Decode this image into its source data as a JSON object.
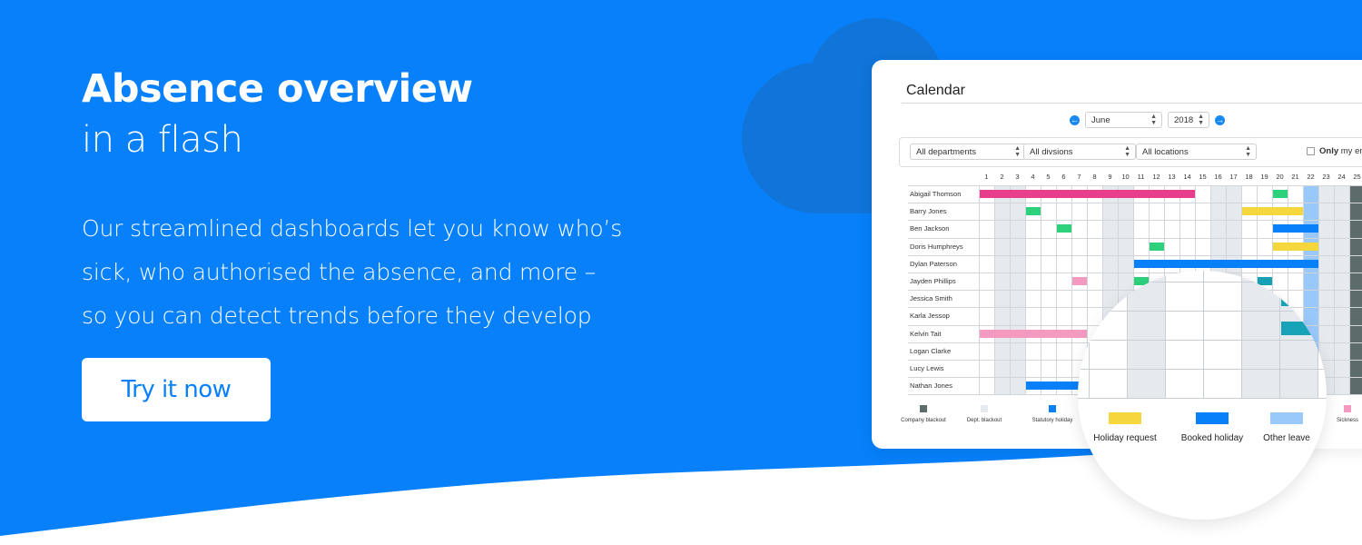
{
  "hero": {
    "headline": "Absence overview",
    "subheadline": "in a flash",
    "body_lines": [
      "Our streamlined dashboards let you know who’s",
      "sick, who authorised the absence, and more –",
      "so you can detect trends before they develop"
    ],
    "cta_label": "Try it now"
  },
  "colors": {
    "brand_blue": "#0780fa",
    "cloud": "#1074d9",
    "weekend": "#e6e9ed",
    "company_blackout": "#5d6b6a",
    "other_leave": "#99c9fb",
    "booked_holiday": "#0780fa",
    "holiday_request": "#f5d63d",
    "sickness": "#f49ac1",
    "authorised": "#2dd17c",
    "magenta": "#e83e8c",
    "teal": "#17a2b8"
  },
  "calendar": {
    "title": "Calendar",
    "month": "June",
    "year": "2018",
    "prev_icon": "arrow-left-circle-icon",
    "next_icon": "arrow-right-circle-icon",
    "filters": {
      "department": "All departments",
      "division": "All divsions",
      "location": "All locations",
      "only_mine_bold": "Only",
      "only_mine_rest": "my em",
      "only_mine_checked": false
    },
    "days": [
      "1",
      "2",
      "3",
      "4",
      "5",
      "6",
      "7",
      "8",
      "9",
      "10",
      "11",
      "12",
      "13",
      "14",
      "15",
      "16",
      "17",
      "18",
      "19",
      "20",
      "21",
      "22",
      "23",
      "24",
      "25"
    ],
    "weekend_days": [
      2,
      3,
      9,
      10,
      16,
      17,
      23,
      24
    ],
    "other_leave_days": [
      22
    ],
    "company_blackout_days": [
      25
    ],
    "employees": [
      {
        "name": "Abigail Thomson",
        "bars": [
          {
            "start": 1,
            "end": 14,
            "type": "magenta"
          },
          {
            "start": 20,
            "end": 20,
            "type": "authorised"
          }
        ]
      },
      {
        "name": "Barry Jones",
        "bars": [
          {
            "start": 4,
            "end": 4,
            "type": "authorised"
          },
          {
            "start": 18,
            "end": 21,
            "type": "holiday_request"
          }
        ]
      },
      {
        "name": "Ben Jackson",
        "bars": [
          {
            "start": 6,
            "end": 6,
            "type": "authorised"
          },
          {
            "start": 20,
            "end": 22,
            "type": "booked_holiday"
          }
        ]
      },
      {
        "name": "Doris Humphreys",
        "bars": [
          {
            "start": 12,
            "end": 12,
            "type": "authorised"
          },
          {
            "start": 20,
            "end": 22,
            "type": "holiday_request"
          }
        ]
      },
      {
        "name": "Dylan Paterson",
        "bars": [
          {
            "start": 11,
            "end": 22,
            "type": "booked_holiday"
          }
        ]
      },
      {
        "name": "Jayden Phillips",
        "bars": [
          {
            "start": 7,
            "end": 7,
            "type": "sickness"
          },
          {
            "start": 11,
            "end": 11,
            "type": "authorised"
          },
          {
            "start": 19,
            "end": 19,
            "type": "teal"
          }
        ]
      },
      {
        "name": "Jessica Smith",
        "bars": []
      },
      {
        "name": "Karla Jessop",
        "bars": []
      },
      {
        "name": "Kelvin Tait",
        "bars": [
          {
            "start": 1,
            "end": 7,
            "type": "sickness"
          }
        ]
      },
      {
        "name": "Logan Clarke",
        "bars": []
      },
      {
        "name": "Lucy Lewis",
        "bars": []
      },
      {
        "name": "Nathan Jones",
        "bars": [
          {
            "start": 4,
            "end": 7,
            "type": "booked_holiday"
          }
        ]
      }
    ],
    "legend": [
      {
        "label": "Company blackout",
        "color_key": "company_blackout"
      },
      {
        "label": "Dept. blackout",
        "color_key": "weekend"
      },
      {
        "label": "Statutory holiday",
        "color_key": "booked_holiday"
      },
      {
        "label": "Sickness",
        "color_key": "sickness"
      }
    ]
  },
  "magnifier": {
    "legend": [
      {
        "label": "Holiday request",
        "color_key": "holiday_request"
      },
      {
        "label": "Booked holiday",
        "color_key": "booked_holiday"
      },
      {
        "label": "Other leave",
        "color_key": "other_leave"
      }
    ]
  }
}
